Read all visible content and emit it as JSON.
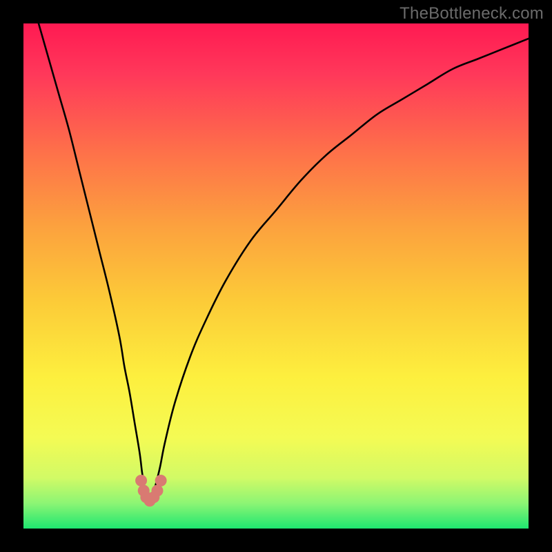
{
  "watermark": "TheBottleneck.com",
  "chart_data": {
    "type": "line",
    "title": "",
    "xlabel": "",
    "ylabel": "",
    "xlim": [
      0,
      100
    ],
    "ylim": [
      0,
      100
    ],
    "series": [
      {
        "name": "bottleneck-curve",
        "x": [
          3,
          5,
          7,
          9,
          11,
          13,
          15,
          17,
          19,
          20,
          21,
          22,
          23,
          23.5,
          24,
          24.5,
          25,
          25.5,
          26,
          27,
          28,
          30,
          33,
          36,
          40,
          45,
          50,
          55,
          60,
          65,
          70,
          75,
          80,
          85,
          90,
          95,
          100
        ],
        "y": [
          100,
          93,
          86,
          79,
          71,
          63,
          55,
          47,
          38,
          32,
          27,
          21,
          15,
          11,
          8,
          6,
          5,
          6,
          8,
          12,
          17,
          25,
          34,
          41,
          49,
          57,
          63,
          69,
          74,
          78,
          82,
          85,
          88,
          91,
          93,
          95,
          97
        ]
      },
      {
        "name": "optimal-zone-markers",
        "x": [
          23.3,
          23.8,
          24.3,
          25.0,
          25.8,
          26.5,
          27.2
        ],
        "y": [
          9.5,
          7.5,
          6.2,
          5.5,
          6.2,
          7.5,
          9.5
        ]
      }
    ],
    "background_gradient": {
      "stops": [
        {
          "pos": 0.0,
          "color": "#ff1a52"
        },
        {
          "pos": 0.1,
          "color": "#ff385a"
        },
        {
          "pos": 0.25,
          "color": "#fe6f4a"
        },
        {
          "pos": 0.4,
          "color": "#fca13e"
        },
        {
          "pos": 0.55,
          "color": "#fccb38"
        },
        {
          "pos": 0.7,
          "color": "#fdef3e"
        },
        {
          "pos": 0.82,
          "color": "#f4fb54"
        },
        {
          "pos": 0.9,
          "color": "#d1fa66"
        },
        {
          "pos": 0.95,
          "color": "#8cf574"
        },
        {
          "pos": 1.0,
          "color": "#1ee670"
        }
      ]
    },
    "marker_color": "#d97a72",
    "curve_color": "#000000"
  }
}
